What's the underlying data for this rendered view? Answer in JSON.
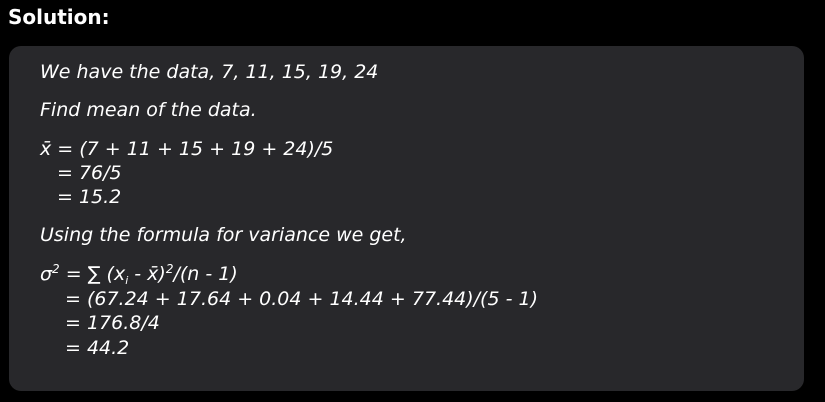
{
  "heading": "Solution:",
  "solution": {
    "data_line": "We have the data, 7, 11, 15, 19, 24",
    "find_mean_line": "Find mean of the data.",
    "mean": {
      "symbol": "x̄",
      "formula": " = (7 + 11 + 15 + 19 + 24)/5",
      "step1": "= 76/5",
      "step2": "= 15.2"
    },
    "variance_intro": "Using the formula for variance we get,",
    "variance": {
      "sigma": "σ",
      "sigma_power": "2",
      "formula_part1": " = ∑ (x",
      "subscript_i": "i",
      "formula_part2": " - x̄)",
      "formula_power": "2",
      "formula_part3": "/(n - 1)",
      "step1": "= (67.24 + 17.64 + 0.04 + 14.44 + 77.44)/(5 - 1)",
      "step2": "= 176.8/4",
      "step3": "= 44.2"
    }
  }
}
